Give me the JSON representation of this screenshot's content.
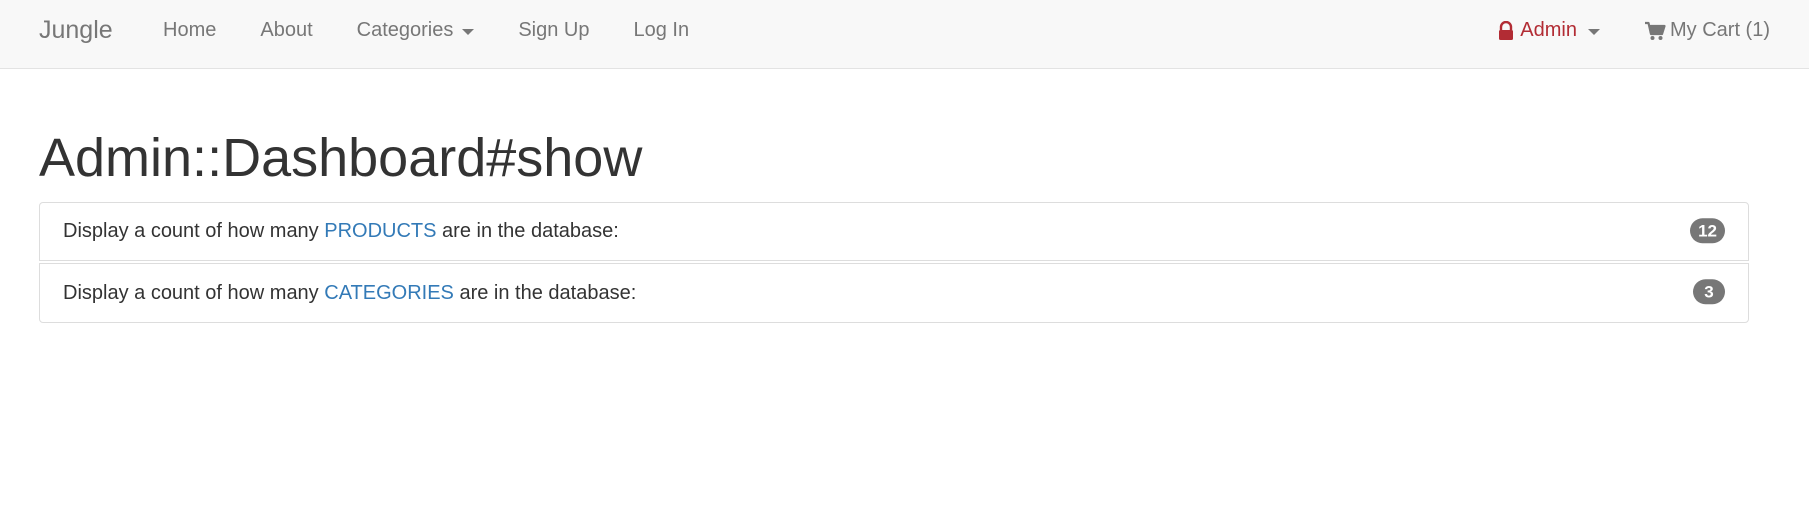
{
  "navbar": {
    "brand": "Jungle",
    "links": {
      "home": "Home",
      "about": "About",
      "categories": "Categories",
      "sign_up": "Sign Up",
      "log_in": "Log In"
    },
    "admin": "Admin",
    "cart": "My Cart (1)"
  },
  "page": {
    "title": "Admin::Dashboard#show"
  },
  "stats": [
    {
      "prefix": "Display a count of how many ",
      "link": "PRODUCTS",
      "suffix": " are in the database:",
      "count": "12"
    },
    {
      "prefix": "Display a count of how many ",
      "link": "CATEGORIES",
      "suffix": " are in the database:",
      "count": "3"
    }
  ],
  "colors": {
    "navbar_bg": "#f8f8f8",
    "admin_accent": "#b22c34",
    "link": "#337ab7",
    "badge": "#777777"
  },
  "icons": {
    "admin": "lock-icon",
    "cart": "shopping-cart-icon",
    "dropdown": "caret-down-icon"
  }
}
